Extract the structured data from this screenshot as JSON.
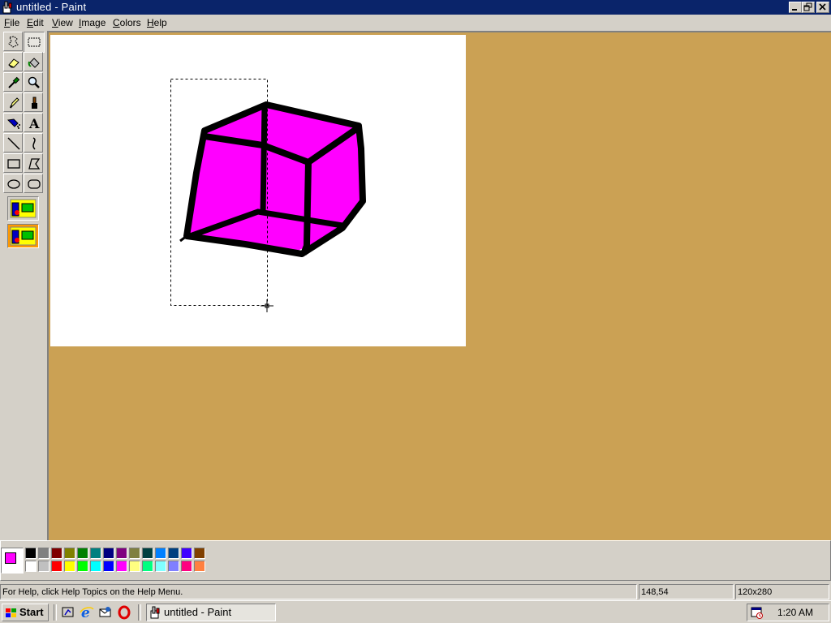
{
  "window": {
    "title": "untitled - Paint",
    "controls": [
      "minimize",
      "restore",
      "close"
    ]
  },
  "menu": {
    "items": [
      "File",
      "Edit",
      "View",
      "Image",
      "Colors",
      "Help"
    ]
  },
  "toolbox": {
    "tools": [
      {
        "name": "free-form-select",
        "icon": "freeform-select-icon"
      },
      {
        "name": "select",
        "icon": "rect-select-icon"
      },
      {
        "name": "eraser",
        "icon": "eraser-icon"
      },
      {
        "name": "fill-with-color",
        "icon": "paint-bucket-icon"
      },
      {
        "name": "pick-color",
        "icon": "eyedropper-icon"
      },
      {
        "name": "magnifier",
        "icon": "magnifier-icon"
      },
      {
        "name": "pencil",
        "icon": "pencil-icon"
      },
      {
        "name": "brush",
        "icon": "brush-icon"
      },
      {
        "name": "airbrush",
        "icon": "airbrush-icon"
      },
      {
        "name": "text",
        "icon": "text-icon",
        "glyph": "A"
      },
      {
        "name": "line",
        "icon": "line-icon"
      },
      {
        "name": "curve",
        "icon": "curve-icon"
      },
      {
        "name": "rectangle",
        "icon": "rectangle-icon"
      },
      {
        "name": "polygon",
        "icon": "polygon-icon"
      },
      {
        "name": "ellipse",
        "icon": "ellipse-icon"
      },
      {
        "name": "rounded-rectangle",
        "icon": "rounded-rectangle-icon"
      }
    ],
    "selected_tool": "select"
  },
  "colors": {
    "foreground": "#ff00ff",
    "background": "#ffffff",
    "palette_top": [
      "#000000",
      "#808080",
      "#800000",
      "#808000",
      "#008000",
      "#008080",
      "#000080",
      "#800080",
      "#808040",
      "#004040",
      "#0080ff",
      "#004080",
      "#4000ff",
      "#804000"
    ],
    "palette_bottom": [
      "#ffffff",
      "#c0c0c0",
      "#ff0000",
      "#ffff00",
      "#00ff00",
      "#00ffff",
      "#0000ff",
      "#ff00ff",
      "#ffff80",
      "#00ff80",
      "#80ffff",
      "#8080ff",
      "#ff0080",
      "#ff8040"
    ],
    "workspace_bg": "#cba154",
    "cube_fill": "#ff00ff"
  },
  "status": {
    "help_text": "For Help, click Help Topics on the Help Menu.",
    "cursor_pos": "148,54",
    "selection_size": "120x280"
  },
  "taskbar": {
    "start_label": "Start",
    "quick_launch": [
      "show-desktop-icon",
      "internet-explorer-icon",
      "outlook-express-icon",
      "opera-icon"
    ],
    "task_label": "untitled - Paint",
    "clock": "1:20 AM"
  }
}
